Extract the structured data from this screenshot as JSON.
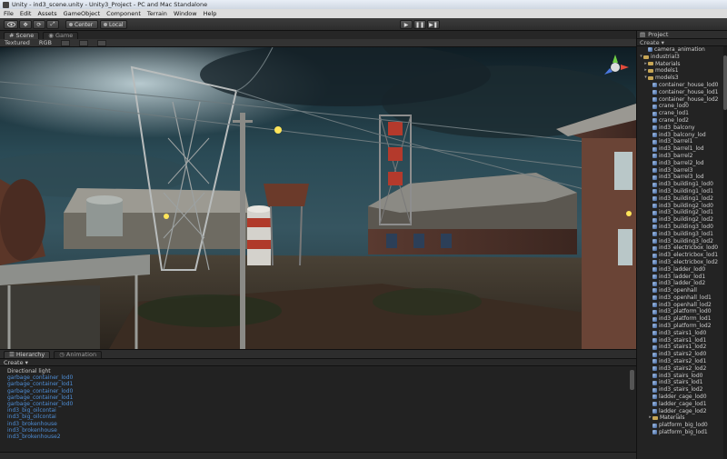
{
  "window": {
    "title": "Unity - ind3_scene.unity - Unity3_Project - PC and Mac Standalone"
  },
  "menu": [
    "File",
    "Edit",
    "Assets",
    "GameObject",
    "Component",
    "Terrain",
    "Window",
    "Help"
  ],
  "toolbar": {
    "pivot": "Center",
    "space": "Local",
    "play": "▶",
    "pause": "❚❚",
    "step": "▶❚"
  },
  "scene_tabs": {
    "scene": "Scene",
    "game": "Game"
  },
  "scene_toolbar": {
    "render_mode": "Textured",
    "color_mode": "RGB"
  },
  "project": {
    "tab": "Project",
    "create": "Create ▾",
    "items": [
      {
        "label": "camera_animation",
        "indent": 1,
        "kind": "mesh"
      },
      {
        "label": "industrial3",
        "indent": 0,
        "kind": "folder",
        "expanded": true
      },
      {
        "label": "Materials",
        "indent": 1,
        "kind": "folder"
      },
      {
        "label": "models1",
        "indent": 1,
        "kind": "folder"
      },
      {
        "label": "models3",
        "indent": 1,
        "kind": "folder",
        "expanded": true
      },
      {
        "label": "container_house_lod0",
        "indent": 2,
        "kind": "mesh"
      },
      {
        "label": "container_house_lod1",
        "indent": 2,
        "kind": "mesh"
      },
      {
        "label": "container_house_lod2",
        "indent": 2,
        "kind": "mesh"
      },
      {
        "label": "crane_lod0",
        "indent": 2,
        "kind": "mesh"
      },
      {
        "label": "crane_lod1",
        "indent": 2,
        "kind": "mesh"
      },
      {
        "label": "crane_lod2",
        "indent": 2,
        "kind": "mesh"
      },
      {
        "label": "ind3_balcony",
        "indent": 2,
        "kind": "mesh"
      },
      {
        "label": "ind3_balcony_lod",
        "indent": 2,
        "kind": "mesh"
      },
      {
        "label": "ind3_barrel1",
        "indent": 2,
        "kind": "mesh"
      },
      {
        "label": "ind3_barrel1_lod",
        "indent": 2,
        "kind": "mesh"
      },
      {
        "label": "ind3_barrel2",
        "indent": 2,
        "kind": "mesh"
      },
      {
        "label": "ind3_barrel2_lod",
        "indent": 2,
        "kind": "mesh"
      },
      {
        "label": "ind3_barrel3",
        "indent": 2,
        "kind": "mesh"
      },
      {
        "label": "ind3_barrel3_lod",
        "indent": 2,
        "kind": "mesh"
      },
      {
        "label": "ind3_building1_lod0",
        "indent": 2,
        "kind": "mesh"
      },
      {
        "label": "ind3_building1_lod1",
        "indent": 2,
        "kind": "mesh"
      },
      {
        "label": "ind3_building1_lod2",
        "indent": 2,
        "kind": "mesh"
      },
      {
        "label": "ind3_building2_lod0",
        "indent": 2,
        "kind": "mesh"
      },
      {
        "label": "ind3_building2_lod1",
        "indent": 2,
        "kind": "mesh"
      },
      {
        "label": "ind3_building2_lod2",
        "indent": 2,
        "kind": "mesh"
      },
      {
        "label": "ind3_building3_lod0",
        "indent": 2,
        "kind": "mesh"
      },
      {
        "label": "ind3_building3_lod1",
        "indent": 2,
        "kind": "mesh"
      },
      {
        "label": "ind3_building3_lod2",
        "indent": 2,
        "kind": "mesh"
      },
      {
        "label": "ind3_electricbox_lod0",
        "indent": 2,
        "kind": "mesh"
      },
      {
        "label": "ind3_electricbox_lod1",
        "indent": 2,
        "kind": "mesh"
      },
      {
        "label": "ind3_electricbox_lod2",
        "indent": 2,
        "kind": "mesh"
      },
      {
        "label": "ind3_ladder_lod0",
        "indent": 2,
        "kind": "mesh"
      },
      {
        "label": "ind3_ladder_lod1",
        "indent": 2,
        "kind": "mesh"
      },
      {
        "label": "ind3_ladder_lod2",
        "indent": 2,
        "kind": "mesh"
      },
      {
        "label": "ind3_openhall",
        "indent": 2,
        "kind": "mesh"
      },
      {
        "label": "ind3_openhall_lod1",
        "indent": 2,
        "kind": "mesh"
      },
      {
        "label": "ind3_openhall_lod2",
        "indent": 2,
        "kind": "mesh"
      },
      {
        "label": "ind3_platform_lod0",
        "indent": 2,
        "kind": "mesh"
      },
      {
        "label": "ind3_platform_lod1",
        "indent": 2,
        "kind": "mesh"
      },
      {
        "label": "ind3_platform_lod2",
        "indent": 2,
        "kind": "mesh"
      },
      {
        "label": "ind3_stairs1_lod0",
        "indent": 2,
        "kind": "mesh"
      },
      {
        "label": "ind3_stairs1_lod1",
        "indent": 2,
        "kind": "mesh"
      },
      {
        "label": "ind3_stairs1_lod2",
        "indent": 2,
        "kind": "mesh"
      },
      {
        "label": "ind3_stairs2_lod0",
        "indent": 2,
        "kind": "mesh"
      },
      {
        "label": "ind3_stairs2_lod1",
        "indent": 2,
        "kind": "mesh"
      },
      {
        "label": "ind3_stairs2_lod2",
        "indent": 2,
        "kind": "mesh"
      },
      {
        "label": "ind3_stairs_lod0",
        "indent": 2,
        "kind": "mesh"
      },
      {
        "label": "ind3_stairs_lod1",
        "indent": 2,
        "kind": "mesh"
      },
      {
        "label": "ind3_stairs_lod2",
        "indent": 2,
        "kind": "mesh"
      },
      {
        "label": "ladder_cage_lod0",
        "indent": 2,
        "kind": "mesh"
      },
      {
        "label": "ladder_cage_lod1",
        "indent": 2,
        "kind": "mesh"
      },
      {
        "label": "ladder_cage_lod2",
        "indent": 2,
        "kind": "mesh"
      },
      {
        "label": "Materials",
        "indent": 2,
        "kind": "folder"
      },
      {
        "label": "platform_big_lod0",
        "indent": 2,
        "kind": "mesh"
      },
      {
        "label": "platform_big_lod1",
        "indent": 2,
        "kind": "mesh"
      }
    ]
  },
  "hierarchy": {
    "tabs": [
      "Hierarchy",
      "Animation"
    ],
    "create": "Create ▾",
    "items": [
      {
        "label": "Directional light",
        "plain": true
      },
      {
        "label": "garbage_container_lod0",
        "plain": false
      },
      {
        "label": "garbage_container_lod1",
        "plain": false
      },
      {
        "label": "garbage_container_lod0",
        "plain": false
      },
      {
        "label": "garbage_container_lod1",
        "plain": false
      },
      {
        "label": "garbage_container_lod0",
        "plain": false
      },
      {
        "label": "ind3_big_oilcontai",
        "plain": false
      },
      {
        "label": "ind3_big_oilcontai",
        "plain": false
      },
      {
        "label": "ind3_brokenhouse",
        "plain": false
      },
      {
        "label": "ind3_brokenhouse",
        "plain": false
      },
      {
        "label": "ind3_brokenhouse2",
        "plain": false
      }
    ]
  },
  "colors": {
    "hierarchy_link": "#4f8fd8",
    "folder": "#c7a656",
    "panel_bg": "#232323"
  }
}
